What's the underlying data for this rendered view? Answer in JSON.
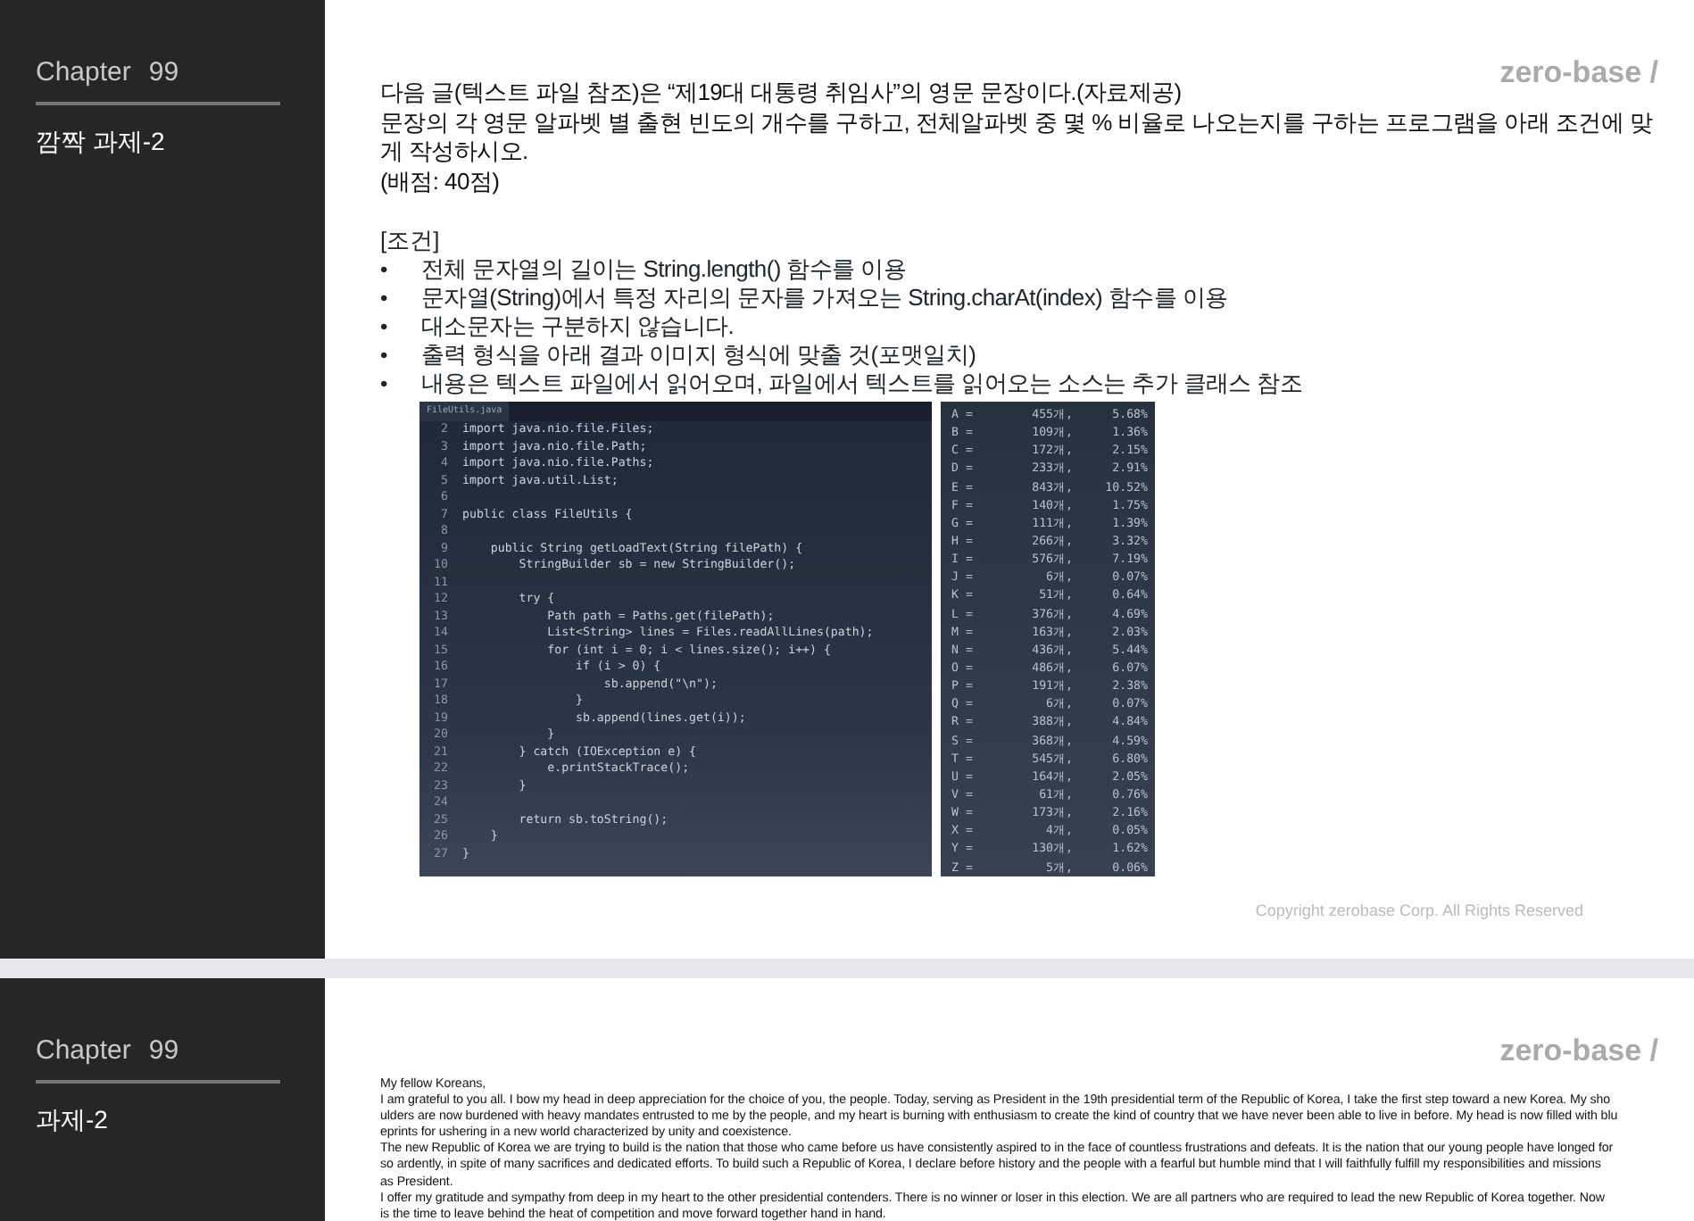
{
  "slides": [
    {
      "sidebar": {
        "chapter_label": "Chapter",
        "chapter_number": "99",
        "title": "깜짝 과제-2"
      },
      "logo": "zero-base /",
      "intro": [
        "다음 글(텍스트 파일 참조)은 “제19대 대통령 취임사”의 영문 문장이다.(자료제공)",
        "문장의 각 영문 알파벳 별 출현 빈도의 개수를 구하고, 전체알파벳 중 몇 % 비율로 나오는지를 구하는 프로그램을 아래 조건에 맞게 작성하시오.",
        "(배점: 40점)"
      ],
      "conditions_heading": "[조건]",
      "conditions": [
        {
          "bullet": "•",
          "text": "전체 문자열의 길이는 String.length() 함수를 이용"
        },
        {
          "bullet": "•",
          "text": "문자열(String)에서 특정 자리의 문자를 가져오는 String.charAt(index) 함수를 이용"
        },
        {
          "bullet": "•",
          "text": "대소문자는 구분하지 않습니다."
        },
        {
          "bullet": "•",
          "text": "출력 형식을 아래 결과 이미지 형식에 맞출 것(포맷일치)"
        },
        {
          "bullet": "•",
          "text": "내용은 텍스트 파일에서 읽어오며, 파일에서 텍스트를 읽어오는 소스는 추가 클래스 참조"
        }
      ],
      "code_editor": {
        "tab": "FileUtils.java",
        "lines": [
          {
            "number": "2",
            "code": "import java.nio.file.Files;"
          },
          {
            "number": "3",
            "code": "import java.nio.file.Path;"
          },
          {
            "number": "4",
            "code": "import java.nio.file.Paths;"
          },
          {
            "number": "5",
            "code": "import java.util.List;"
          },
          {
            "number": "6"
          },
          {
            "number": "7",
            "code": "public class FileUtils {"
          },
          {
            "number": "8"
          },
          {
            "number": "9",
            "code": "    public String getLoadText(String filePath) {"
          },
          {
            "number": "10",
            "code": "        StringBuilder sb = new StringBuilder();"
          },
          {
            "number": "11"
          },
          {
            "number": "12",
            "code": "        try {"
          },
          {
            "number": "13",
            "code": "            Path path = Paths.get(filePath);"
          },
          {
            "number": "14",
            "code": "            List<String> lines = Files.readAllLines(path);"
          },
          {
            "number": "15",
            "code": "            for (int i = 0; i < lines.size(); i++) {"
          },
          {
            "number": "16",
            "code": "                if (i > 0) {"
          },
          {
            "number": "17",
            "code": "                    sb.append(\"\\n\");"
          },
          {
            "number": "18",
            "code": "                }"
          },
          {
            "number": "19",
            "code": "                sb.append(lines.get(i));"
          },
          {
            "number": "20",
            "code": "            }"
          },
          {
            "number": "21",
            "code": "        } catch (IOException e) {"
          },
          {
            "number": "22",
            "code": "            e.printStackTrace();"
          },
          {
            "number": "23",
            "code": "        }"
          },
          {
            "number": "24"
          },
          {
            "number": "25",
            "code": "        return sb.toString();"
          },
          {
            "number": "26",
            "code": "    }"
          },
          {
            "number": "27",
            "code": "}"
          }
        ]
      },
      "console_output": [
        {
          "letter": "A =",
          "count": "455개,",
          "percent": "5.68%"
        },
        {
          "letter": "B =",
          "count": "109개,",
          "percent": "1.36%"
        },
        {
          "letter": "C =",
          "count": "172개,",
          "percent": "2.15%"
        },
        {
          "letter": "D =",
          "count": "233개,",
          "percent": "2.91%"
        },
        {
          "letter": "E =",
          "count": "843개,",
          "percent": "10.52%"
        },
        {
          "letter": "F =",
          "count": "140개,",
          "percent": "1.75%"
        },
        {
          "letter": "G =",
          "count": "111개,",
          "percent": "1.39%"
        },
        {
          "letter": "H =",
          "count": "266개,",
          "percent": "3.32%"
        },
        {
          "letter": "I =",
          "count": "576개,",
          "percent": "7.19%"
        },
        {
          "letter": "J =",
          "count": "6개,",
          "percent": "0.07%"
        },
        {
          "letter": "K =",
          "count": "51개,",
          "percent": "0.64%"
        },
        {
          "letter": "L =",
          "count": "376개,",
          "percent": "4.69%"
        },
        {
          "letter": "M =",
          "count": "163개,",
          "percent": "2.03%"
        },
        {
          "letter": "N =",
          "count": "436개,",
          "percent": "5.44%"
        },
        {
          "letter": "O =",
          "count": "486개,",
          "percent": "6.07%"
        },
        {
          "letter": "P =",
          "count": "191개,",
          "percent": "2.38%"
        },
        {
          "letter": "Q =",
          "count": "6개,",
          "percent": "0.07%"
        },
        {
          "letter": "R =",
          "count": "388개,",
          "percent": "4.84%"
        },
        {
          "letter": "S =",
          "count": "368개,",
          "percent": "4.59%"
        },
        {
          "letter": "T =",
          "count": "545개,",
          "percent": "6.80%"
        },
        {
          "letter": "U =",
          "count": "164개,",
          "percent": "2.05%"
        },
        {
          "letter": "V =",
          "count": "61개,",
          "percent": "0.76%"
        },
        {
          "letter": "W =",
          "count": "173개,",
          "percent": "2.16%"
        },
        {
          "letter": "X =",
          "count": "4개,",
          "percent": "0.05%"
        },
        {
          "letter": "Y =",
          "count": "130개,",
          "percent": "1.62%"
        },
        {
          "letter": "Z =",
          "count": "5개,",
          "percent": "0.06%"
        }
      ],
      "copyright": "Copyright zerobase Corp. All Rights Reserved"
    },
    {
      "sidebar": {
        "chapter_label": "Chapter",
        "chapter_number": "99",
        "title": "과제-2"
      },
      "logo": "zero-base /",
      "document_lines": [
        "My fellow Koreans,",
        "I am grateful to you all. I bow my head in deep appreciation for the choice of you, the people. Today, serving as President in the 19th presidential term of the Republic of Korea, I take the first step toward a new Korea. My  sho",
        "ulders are now burdened with heavy mandates entrusted to me by the people, and my heart is burning with enthusiasm to create the kind of country that we have never been able to live in before. My head is now filled with  blu",
        "eprints for ushering in a new world characterized by unity and coexistence.",
        "The new Republic of Korea we are trying to build is the nation that those who came before us have consistently aspired to in the face of countless frustrations and defeats. It is the nation that our young people have longed for",
        "so ardently, in spite of many sacrifices and dedicated efforts. To build such a Republic of Korea, I declare before history and the people with a fearful but humble mind that I will faithfully fulfill my responsibilities and missions",
        "as President.",
        "I offer my gratitude and sympathy from deep in my heart to the other presidential contenders. There is no winner or loser in this election. We are all partners who are required to lead the new Republic of Korea together. Now",
        "is the time to leave behind the heat of competition and move forward together hand in hand."
      ]
    }
  ]
}
